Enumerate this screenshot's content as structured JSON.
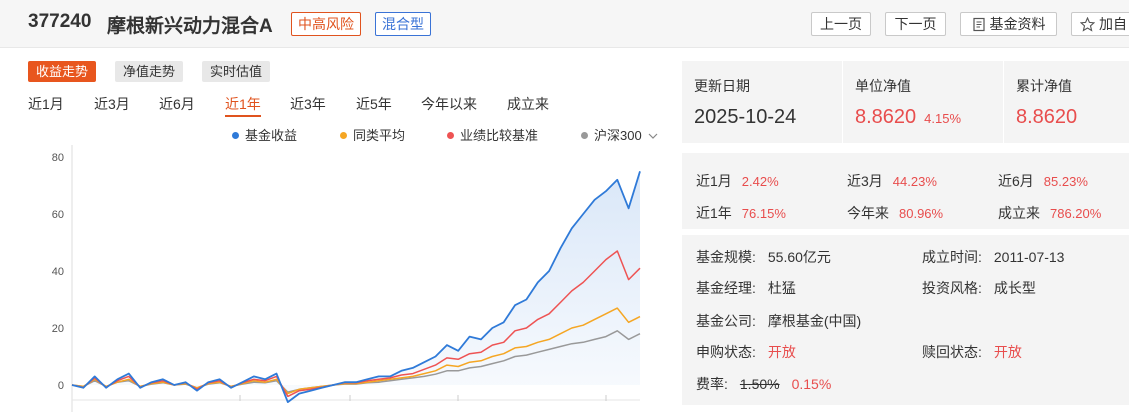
{
  "header": {
    "fund_code": "377240",
    "fund_name": "摩根新兴动力混合A",
    "risk_tag": "中高风险",
    "type_tag": "混合型",
    "prev_label": "上一页",
    "next_label": "下一页",
    "info_label": "基金资料",
    "fav_label": "加自"
  },
  "chart_tabs": [
    {
      "label": "收益走势",
      "active": true
    },
    {
      "label": "净值走势",
      "active": false
    },
    {
      "label": "实时估值",
      "active": false
    }
  ],
  "ranges": [
    {
      "label": "近1月",
      "active": false
    },
    {
      "label": "近3月",
      "active": false
    },
    {
      "label": "近6月",
      "active": false
    },
    {
      "label": "近1年",
      "active": true
    },
    {
      "label": "近3年",
      "active": false
    },
    {
      "label": "近5年",
      "active": false
    },
    {
      "label": "今年以来",
      "active": false
    },
    {
      "label": "成立来",
      "active": false
    }
  ],
  "legend": [
    "基金收益",
    "同类平均",
    "业绩比较基准",
    "沪深300"
  ],
  "colors": {
    "accent": "#e8561e",
    "fund": "#2f7ad8",
    "peer": "#f5a623",
    "benchmark": "#ee5353",
    "index": "#999999",
    "up": "#e84d4d"
  },
  "icons": {
    "star": "star-icon",
    "doc": "document-icon",
    "dropdown": "chevron-down-icon"
  },
  "chart_data": {
    "type": "line",
    "title": "",
    "xlabel": "",
    "ylabel": "",
    "ylim": [
      -5,
      80
    ],
    "yticks": [
      0,
      20,
      40,
      60,
      80
    ],
    "grid": false,
    "legend_position": "top",
    "x": [
      0,
      2,
      4,
      6,
      8,
      10,
      12,
      14,
      16,
      18,
      20,
      22,
      24,
      26,
      28,
      30,
      32,
      34,
      36,
      38,
      40,
      42,
      44,
      46,
      48,
      50,
      52,
      54,
      56,
      58,
      60,
      62,
      64,
      66,
      68,
      70,
      72,
      74,
      76,
      78,
      80,
      82,
      84,
      86,
      88,
      90,
      92,
      94,
      96,
      98,
      100
    ],
    "series": [
      {
        "name": "基金收益",
        "values": [
          0,
          -1,
          3,
          -1,
          2,
          4,
          -1,
          1,
          2,
          0,
          1,
          -2,
          1,
          2,
          -1,
          1,
          3,
          2,
          4,
          -6,
          -3,
          -2,
          -1,
          0,
          1,
          1,
          2,
          3,
          3,
          5,
          6,
          8,
          10,
          14,
          12,
          17,
          16,
          20,
          22,
          28,
          30,
          36,
          40,
          48,
          55,
          60,
          65,
          68,
          72,
          62,
          75
        ]
      },
      {
        "name": "同类平均",
        "values": [
          0,
          -0.5,
          2,
          -0.5,
          1,
          2,
          -0.5,
          0.5,
          1,
          0,
          0.5,
          -1,
          0.5,
          1,
          -0.5,
          0.5,
          1.5,
          1,
          2,
          -3,
          -1.5,
          -1,
          -0.5,
          0,
          0.5,
          0.5,
          1,
          1.5,
          2,
          2.5,
          3,
          4,
          5,
          7,
          6.5,
          8,
          8.5,
          10,
          11,
          13,
          13.5,
          15,
          16,
          18,
          20,
          21,
          23,
          25,
          27,
          22,
          24
        ]
      },
      {
        "name": "业绩比较基准",
        "values": [
          0,
          -0.8,
          2.5,
          -0.8,
          1.5,
          3,
          -0.8,
          0.8,
          1.5,
          0,
          0.8,
          -1.5,
          0.8,
          1.5,
          -0.8,
          0.8,
          2,
          1.5,
          3,
          -4,
          -2,
          -1.5,
          -0.8,
          0,
          0.8,
          0.8,
          1.5,
          2,
          2.5,
          3.5,
          4,
          5.5,
          7,
          9.5,
          9,
          11,
          11.5,
          14,
          15,
          19,
          20,
          23,
          25,
          29,
          33,
          36,
          40,
          44,
          47,
          37,
          41
        ]
      },
      {
        "name": "沪深300",
        "values": [
          0,
          -0.5,
          1.5,
          -0.5,
          1,
          1.5,
          -0.5,
          0.3,
          0.8,
          0,
          0.3,
          -1,
          0.3,
          0.8,
          -0.5,
          0.3,
          1,
          0.8,
          1.5,
          -2.5,
          -1.5,
          -1,
          -0.5,
          0,
          0.3,
          0.3,
          0.8,
          1,
          1.5,
          2,
          2.5,
          3,
          3.8,
          5,
          5,
          6,
          6.5,
          7.5,
          8.5,
          10,
          10.5,
          11.5,
          12.5,
          13.5,
          14.5,
          15,
          16,
          17,
          19,
          16,
          18
        ]
      }
    ]
  },
  "summary": {
    "date_label": "更新日期",
    "date_value": "2025-10-24",
    "nav_label": "单位净值",
    "nav_value": "8.8620",
    "nav_change": "4.15%",
    "acc_label": "累计净值",
    "acc_value": "8.8620"
  },
  "performance": [
    {
      "label": "近1月",
      "value": "2.42%"
    },
    {
      "label": "近3月",
      "value": "44.23%"
    },
    {
      "label": "近6月",
      "value": "85.23%"
    },
    {
      "label": "近1年",
      "value": "76.15%"
    },
    {
      "label": "今年来",
      "value": "80.96%"
    },
    {
      "label": "成立来",
      "value": "786.20%"
    }
  ],
  "details": {
    "scale_label": "基金规模:",
    "scale_value": "55.60亿元",
    "inception_label": "成立时间:",
    "inception_value": "2011-07-13",
    "manager_label": "基金经理:",
    "manager_value": "杜猛",
    "style_label": "投资风格:",
    "style_value": "成长型",
    "company_label": "基金公司:",
    "company_value": "摩根基金(中国)",
    "purchase_label": "申购状态:",
    "purchase_value": "开放",
    "redeem_label": "赎回状态:",
    "redeem_value": "开放",
    "fee_label": "费率:",
    "fee_original": "1.50%",
    "fee_value": "0.15%"
  }
}
